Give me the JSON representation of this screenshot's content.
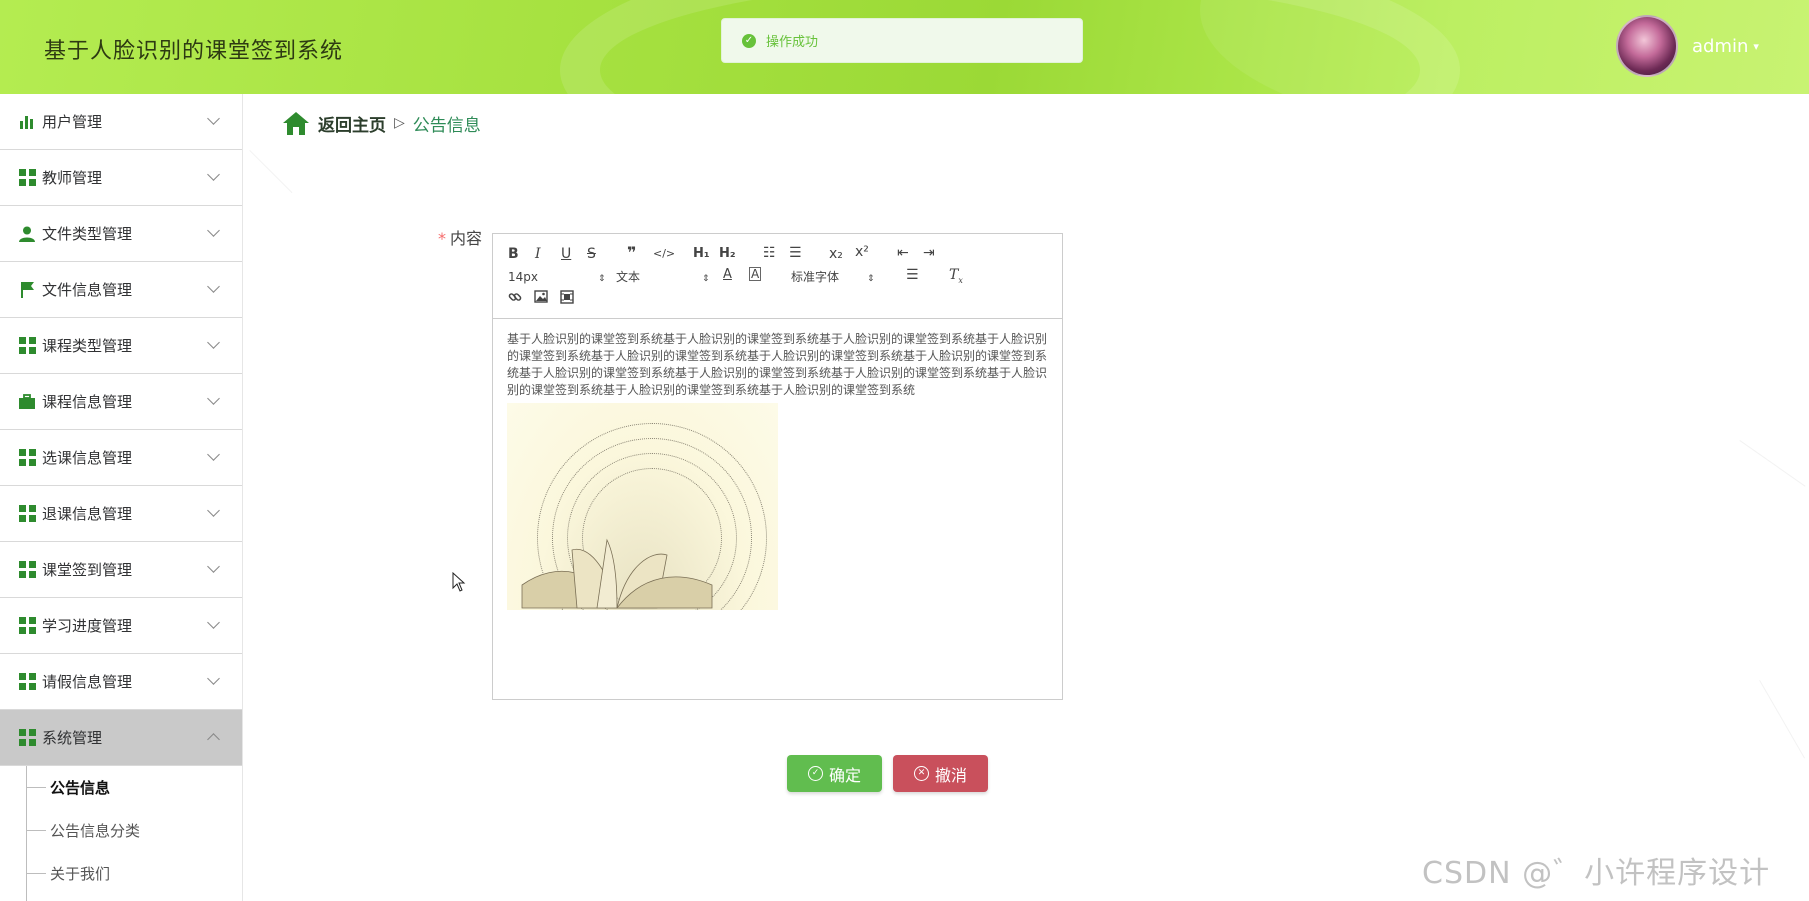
{
  "header": {
    "app_title": "基于人脸识别的课堂签到系统",
    "toast_message": "操作成功",
    "username": "admin"
  },
  "sidebar": {
    "items": [
      {
        "label": "用户管理",
        "icon": "bar-chart-icon"
      },
      {
        "label": "教师管理",
        "icon": "grid-icon"
      },
      {
        "label": "文件类型管理",
        "icon": "user-icon"
      },
      {
        "label": "文件信息管理",
        "icon": "flag-icon"
      },
      {
        "label": "课程类型管理",
        "icon": "grid-icon"
      },
      {
        "label": "课程信息管理",
        "icon": "briefcase-icon"
      },
      {
        "label": "选课信息管理",
        "icon": "grid-icon"
      },
      {
        "label": "退课信息管理",
        "icon": "grid-icon"
      },
      {
        "label": "课堂签到管理",
        "icon": "grid-icon"
      },
      {
        "label": "学习进度管理",
        "icon": "grid-icon"
      },
      {
        "label": "请假信息管理",
        "icon": "grid-icon"
      },
      {
        "label": "系统管理",
        "icon": "grid-icon"
      }
    ],
    "submenu": [
      "公告信息",
      "公告信息分类",
      "关于我们"
    ]
  },
  "breadcrumb": {
    "back": "返回主页",
    "separator": "▷",
    "current": "公告信息"
  },
  "form": {
    "required_mark": "*",
    "content_label": "内容"
  },
  "editor": {
    "font_size": "14px",
    "header_select": "文本",
    "font_family": "标准字体",
    "body_text": "基于人脸识别的课堂签到系统基于人脸识别的课堂签到系统基于人脸识别的课堂签到系统基于人脸识别的课堂签到系统基于人脸识别的课堂签到系统基于人脸识别的课堂签到系统基于人脸识别的课堂签到系统基于人脸识别的课堂签到系统基于人脸识别的课堂签到系统基于人脸识别的课堂签到系统基于人脸识别的课堂签到系统基于人脸识别的课堂签到系统基于人脸识别的课堂签到系统"
  },
  "buttons": {
    "confirm": "确定",
    "cancel": "撤消"
  },
  "watermark": "CSDN @゛小许程序设计",
  "colors": {
    "header_green": "#a7e241",
    "icon_green": "#2e8b2e",
    "confirm_green": "#61bd4f",
    "cancel_red": "#c9505c",
    "toast_green": "#67c23a"
  }
}
